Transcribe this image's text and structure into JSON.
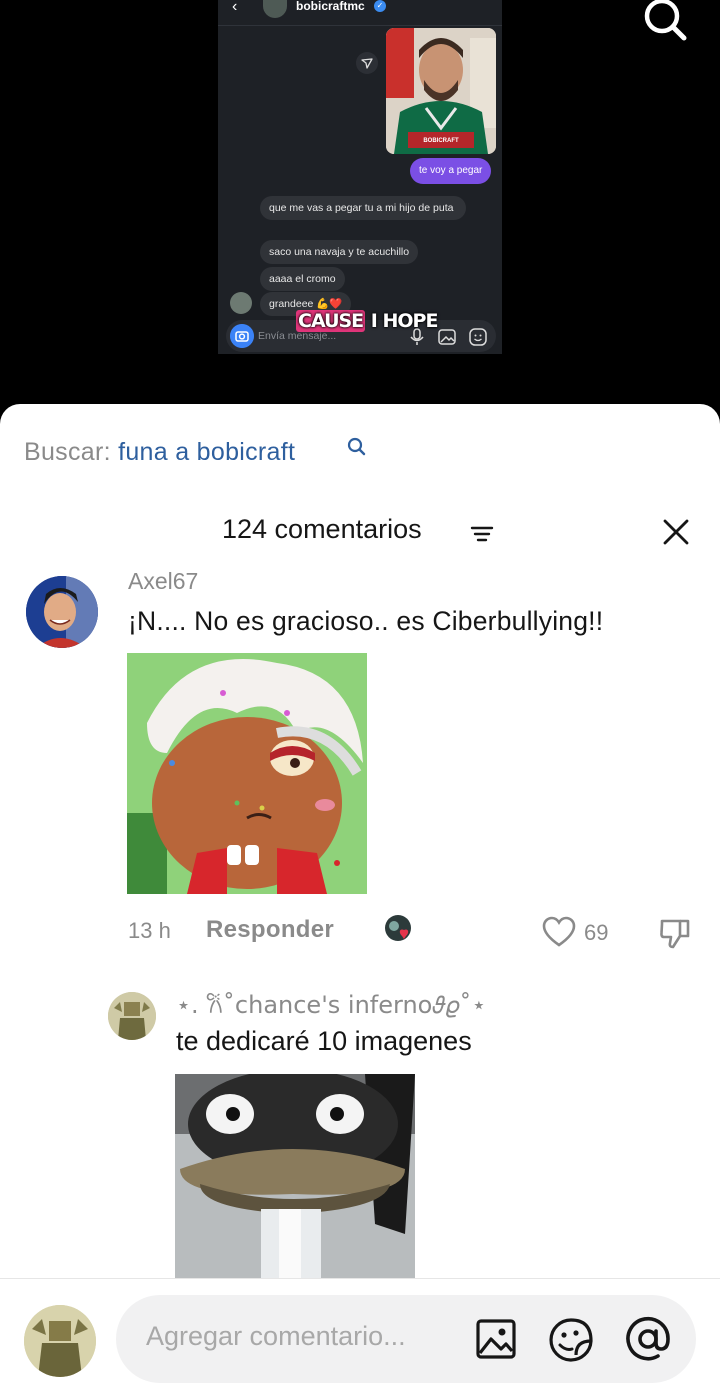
{
  "video": {
    "chat": {
      "username": "bobicraftmc",
      "photo_caption": "BOBICRAFT",
      "outgoing_message": "te voy a pegar",
      "incoming_messages": [
        "que me vas a pegar tu a mi hijo de puta",
        "saco una navaja y te acuchillo",
        "aaaa el cromo",
        "grandeee 💪❤️"
      ],
      "input_placeholder": "Envía mensaje..."
    },
    "caption_highlight": "CAUSE",
    "caption_rest": "I HOPE"
  },
  "search": {
    "label": "Buscar:",
    "query": "funa a bobicraft"
  },
  "comments_header": {
    "count_label": "124 comentarios"
  },
  "comments": [
    {
      "username": "Axel67",
      "text": "¡N.... No es gracioso.. es Ciberbullying!!",
      "time": "13 h",
      "reply_label": "Responder",
      "likes": "69"
    },
    {
      "username": "⋆. 𐙚˚chance's inferno𝜗𝜚˚⋆",
      "text": "te dedicaré 10 imagenes"
    }
  ],
  "composer": {
    "placeholder": "Agregar comentario..."
  },
  "colors": {
    "accent_blue": "#2e5f9e",
    "chat_purple": "#7b4fe5",
    "caption_pink": "#e0357a",
    "like_red": "#e5344b"
  }
}
